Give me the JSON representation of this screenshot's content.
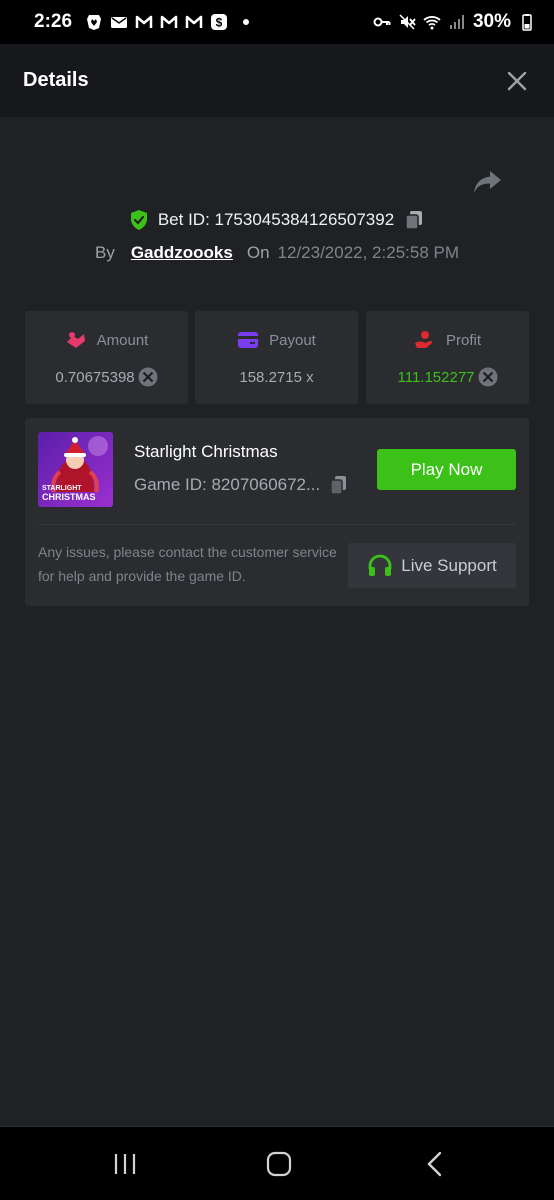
{
  "status_bar": {
    "time": "2:26",
    "battery": "30%",
    "left_icons": [
      "brave-icon",
      "mail-icon",
      "gmail-icon",
      "gmail-icon",
      "gmail-icon",
      "cash-app-icon",
      "notification-dot"
    ],
    "right_icons": [
      "vpn-key-icon",
      "mute-icon",
      "wifi-icon",
      "signal-icon",
      "battery-icon"
    ]
  },
  "header": {
    "title": "Details",
    "close_icon": "close-icon"
  },
  "bet": {
    "bet_id_text": "Bet ID: 1753045384126507392",
    "by_label": "By",
    "username": "Gaddzoooks",
    "on_label": "On",
    "date": "12/23/2022, 2:25:58 PM"
  },
  "stats": [
    {
      "label": "Amount",
      "value": "0.70675398",
      "icon": "amount-icon",
      "value_color": "#a7abb1",
      "icon_color": "#e8396c",
      "coin": "coin-icon"
    },
    {
      "label": "Payout",
      "value": "158.2715 x",
      "icon": "payout-card-icon",
      "value_color": "#a7abb1",
      "icon_color": "#7b3df0"
    },
    {
      "label": "Profit",
      "value": "111.152277",
      "icon": "profit-hand-icon",
      "value_color": "#3bc117",
      "icon_color": "#e0292f",
      "coin": "coin-icon"
    }
  ],
  "game": {
    "name": "Starlight Christmas",
    "game_id": "Game ID: 8207060672...",
    "thumb_caption_line1": "STARLIGHT",
    "thumb_caption_line2": "CHRISTMAS",
    "play_label": "Play Now",
    "support_text": "Any issues, please contact the customer service for help and provide the game ID.",
    "support_label": "Live Support"
  },
  "colors": {
    "accent_green": "#3bc117",
    "background": "#202124",
    "panel": "#2a2c30",
    "header": "#17181b"
  }
}
